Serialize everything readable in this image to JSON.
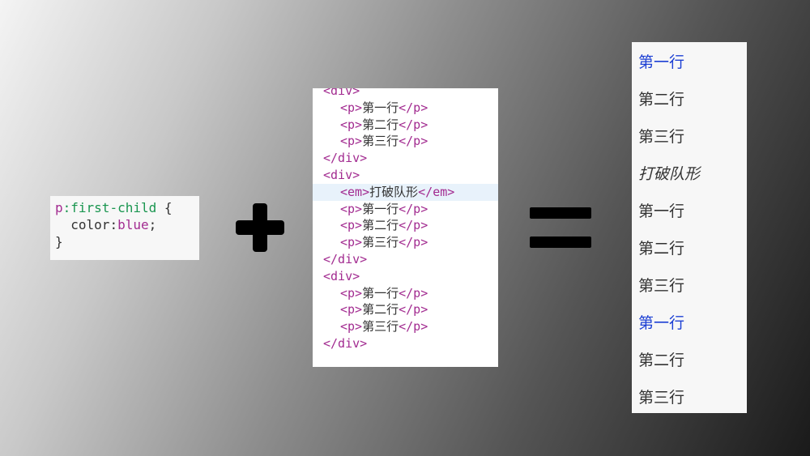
{
  "css_rule": {
    "selector_element": "p",
    "selector_pseudo": ":first-child",
    "open_brace": " {",
    "property": "color",
    "colon": ":",
    "value": "blue",
    "semicolon": ";",
    "close_brace": "}"
  },
  "operators": {
    "plus_icon": "plus-icon",
    "equals_icon": "equals-icon"
  },
  "html_code": {
    "lines": [
      {
        "open": "<div>",
        "text": "",
        "close": ""
      },
      {
        "open": "<p>",
        "text": "第一行",
        "close": "</p>"
      },
      {
        "open": "<p>",
        "text": "第二行",
        "close": "</p>"
      },
      {
        "open": "<p>",
        "text": "第三行",
        "close": "</p>"
      },
      {
        "open": "</div>",
        "text": "",
        "close": ""
      },
      {
        "open": "<div>",
        "text": "",
        "close": ""
      },
      {
        "open": "<em>",
        "text": "打破队形",
        "close": "</em>"
      },
      {
        "open": "<p>",
        "text": "第一行",
        "close": "</p>"
      },
      {
        "open": "<p>",
        "text": "第二行",
        "close": "</p>"
      },
      {
        "open": "<p>",
        "text": "第三行",
        "close": "</p>"
      },
      {
        "open": "</div>",
        "text": "",
        "close": ""
      },
      {
        "open": "<div>",
        "text": "",
        "close": ""
      },
      {
        "open": "<p>",
        "text": "第一行",
        "close": "</p>"
      },
      {
        "open": "<p>",
        "text": "第二行",
        "close": "</p>"
      },
      {
        "open": "<p>",
        "text": "第三行",
        "close": "</p>"
      },
      {
        "open": "</div>",
        "text": "",
        "close": ""
      }
    ]
  },
  "result": {
    "lines": [
      {
        "text": "第一行",
        "color": "#1c3fd4",
        "italic": false
      },
      {
        "text": "第二行",
        "color": "#333333",
        "italic": false
      },
      {
        "text": "第三行",
        "color": "#333333",
        "italic": false
      },
      {
        "text": "打破队形",
        "color": "#333333",
        "italic": true
      },
      {
        "text": "第一行",
        "color": "#333333",
        "italic": false
      },
      {
        "text": "第二行",
        "color": "#333333",
        "italic": false
      },
      {
        "text": "第三行",
        "color": "#333333",
        "italic": false
      },
      {
        "text": "第一行",
        "color": "#1c3fd4",
        "italic": false
      },
      {
        "text": "第二行",
        "color": "#333333",
        "italic": false
      },
      {
        "text": "第三行",
        "color": "#333333",
        "italic": false
      }
    ]
  },
  "colors": {
    "tag": "#a22b90",
    "pseudo": "#1a9650",
    "blue_result": "#1c3fd4",
    "highlight_row": "#e8f2fb"
  }
}
